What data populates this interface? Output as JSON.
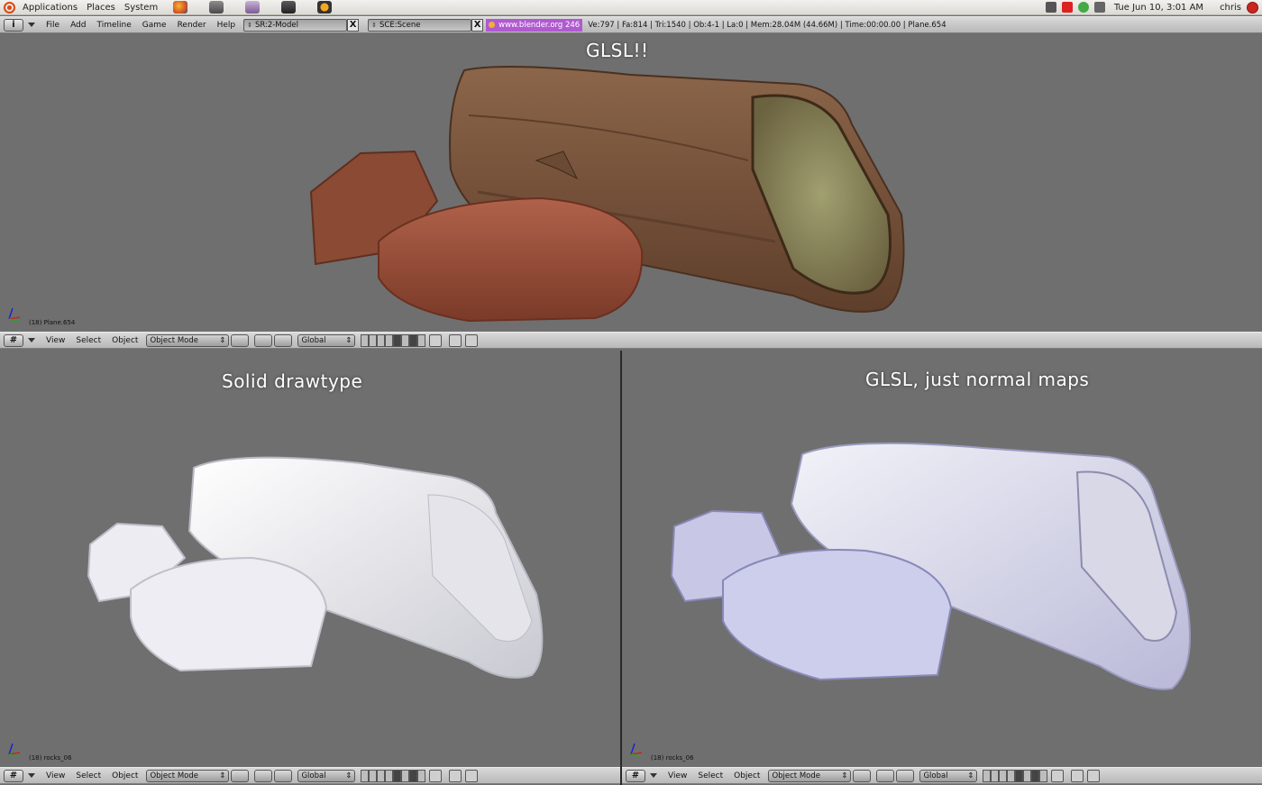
{
  "panel": {
    "menus": [
      "Applications",
      "Places",
      "System"
    ],
    "clock": "Tue Jun 10,  3:01 AM",
    "user": "chris"
  },
  "top_header": {
    "menus": [
      "File",
      "Add",
      "Timeline",
      "Game",
      "Render",
      "Help"
    ],
    "screen_field": "SR:2-Model",
    "scene_field": "SCE:Scene",
    "web_link": "www.blender.org 246",
    "stats": "Ve:797 | Fa:814 | Tri:1540 | Ob:4-1 | La:0  | Mem:28.04M (44.66M)  | Time:00:00.00 | Plane.654"
  },
  "viewports": {
    "top": {
      "label": "GLSL!!",
      "object_info": "(18) Plane.654",
      "header": {
        "menus": [
          "View",
          "Select",
          "Object"
        ],
        "mode": "Object Mode",
        "orientation": "Global"
      }
    },
    "bottom_left": {
      "label": "Solid drawtype",
      "object_info": "(18) rocks_06",
      "header": {
        "menus": [
          "View",
          "Select",
          "Object"
        ],
        "mode": "Object Mode",
        "orientation": "Global"
      }
    },
    "bottom_right": {
      "label": "GLSL, just normal maps",
      "object_info": "(18) rocks_06",
      "header": {
        "menus": [
          "View",
          "Select",
          "Object"
        ],
        "mode": "Object Mode",
        "orientation": "Global"
      }
    }
  },
  "colors": {
    "viewport_bg": "#6f6f6f",
    "wood": "#7a5538",
    "rock": "#9a4e38",
    "solid_white": "#eeeef3",
    "normal_blue": "#c9c9ec"
  }
}
